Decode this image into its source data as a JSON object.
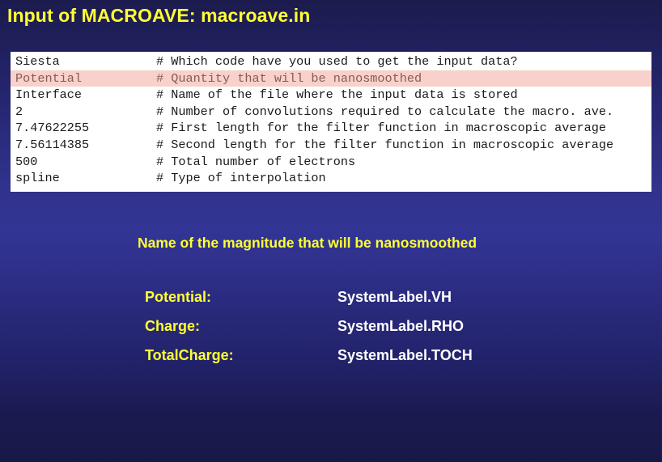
{
  "slide": {
    "title": "Input of MACROAVE: macroave.in"
  },
  "code_file": {
    "lines": [
      {
        "value": "Siesta",
        "comment": "# Which code have you used to get the input data?",
        "highlighted": false
      },
      {
        "value": "Potential",
        "comment": "# Quantity that will be nanosmoothed",
        "highlighted": true
      },
      {
        "value": "Interface",
        "comment": "# Name of the file where the input data is stored",
        "highlighted": false
      },
      {
        "value": "2",
        "comment": "# Number of convolutions required to calculate the macro. ave.",
        "highlighted": false
      },
      {
        "value": "7.47622255",
        "comment": "# First length for the filter function in macroscopic average",
        "highlighted": false
      },
      {
        "value": "7.56114385",
        "comment": "# Second length for the filter function in macroscopic average",
        "highlighted": false
      },
      {
        "value": "500",
        "comment": "# Total number of electrons",
        "highlighted": false
      },
      {
        "value": "spline",
        "comment": "# Type of interpolation",
        "highlighted": false
      }
    ],
    "highlight_color": "#f8d0cc"
  },
  "explanation": {
    "subtitle": "Name of the magnitude that will be nanosmoothed",
    "mappings": [
      {
        "key": "Potential:",
        "value": "SystemLabel.VH"
      },
      {
        "key": "Charge:",
        "value": "SystemLabel.RHO"
      },
      {
        "key": "TotalCharge:",
        "value": "SystemLabel.TOCH"
      }
    ]
  },
  "colors": {
    "title_yellow": "#ffff33",
    "value_white": "#ffffff",
    "background_top": "#1c1b4d",
    "background_mid": "#333595",
    "background_bottom": "#181848"
  }
}
